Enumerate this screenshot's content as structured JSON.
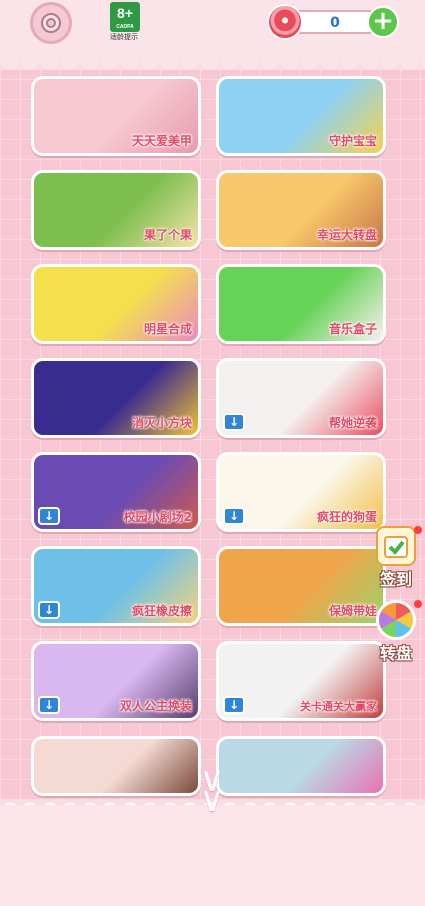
{
  "header": {
    "gear_icon": "gear-icon",
    "age_rating": "8+",
    "age_org": "CADPA",
    "age_tip": "适龄提示",
    "coin_value": "0",
    "candy_icon": "lollipop-icon",
    "plus_icon": "plus-icon"
  },
  "games": [
    {
      "title": "天天爱美甲",
      "download": false,
      "colors": [
        "#f6c8cf",
        "#e89ab0"
      ]
    },
    {
      "title": "守护宝宝",
      "download": false,
      "colors": [
        "#8ed1f2",
        "#f5d24b"
      ]
    },
    {
      "title": "果了个果",
      "download": false,
      "colors": [
        "#7dbf4f",
        "#f6e2a6"
      ]
    },
    {
      "title": "幸运大转盘",
      "download": false,
      "colors": [
        "#f7c96a",
        "#c7774a"
      ]
    },
    {
      "title": "明星合成",
      "download": false,
      "colors": [
        "#f4e04d",
        "#e98abf"
      ]
    },
    {
      "title": "音乐盒子",
      "download": false,
      "colors": [
        "#64d356",
        "#fbeff2"
      ]
    },
    {
      "title": "消灭小方块",
      "download": false,
      "colors": [
        "#3a2b8f",
        "#f1c232"
      ]
    },
    {
      "title": "帮她逆袭",
      "download": true,
      "colors": [
        "#f5f0f0",
        "#e74f5d"
      ]
    },
    {
      "title": "校园小剧场2",
      "download": true,
      "colors": [
        "#6a4bb3",
        "#d05a4a"
      ]
    },
    {
      "title": "疯狂的狗蛋",
      "download": true,
      "colors": [
        "#fbf7ea",
        "#f0c04a"
      ]
    },
    {
      "title": "疯狂橡皮擦",
      "download": true,
      "colors": [
        "#6fc0e8",
        "#f5d37a"
      ]
    },
    {
      "title": "保姆带娃",
      "download": false,
      "colors": [
        "#f1a54a",
        "#9bd16a"
      ]
    },
    {
      "title": "双人公主换装",
      "download": true,
      "colors": [
        "#d8b8ef",
        "#5a3c6e"
      ]
    },
    {
      "title": "关卡通关大赢家",
      "download": true,
      "colors": [
        "#f2f2f2",
        "#c43d3d"
      ]
    },
    {
      "title": "",
      "download": false,
      "colors": [
        "#f4dad2",
        "#7a4a3a"
      ]
    },
    {
      "title": "",
      "download": false,
      "colors": [
        "#b9d9e6",
        "#e872b4"
      ]
    }
  ],
  "side": {
    "checkin_label": "签到",
    "wheel_label": "转盘"
  },
  "scroll_hint_icon": "chevron-down-icon"
}
